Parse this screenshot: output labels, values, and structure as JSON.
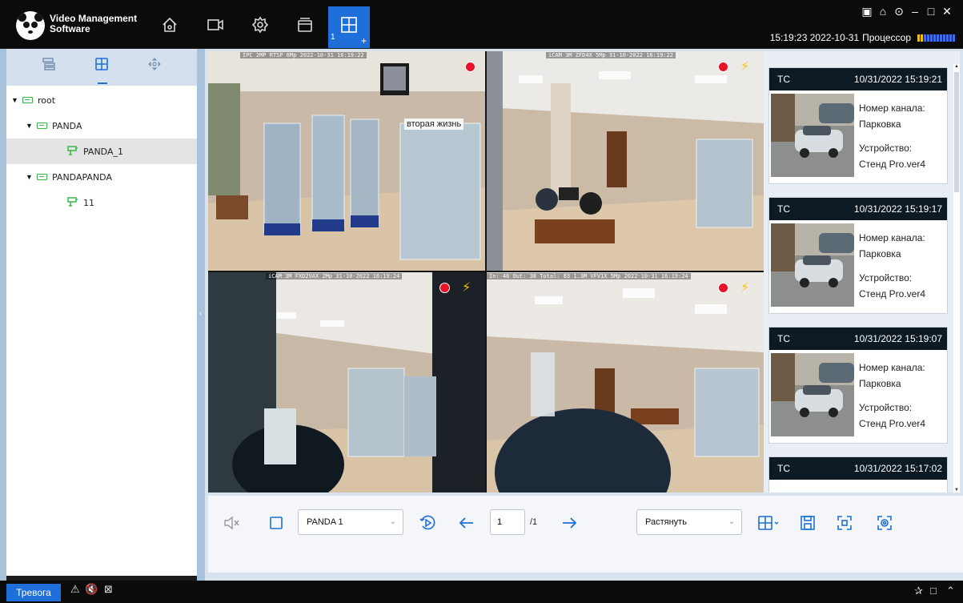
{
  "app": {
    "name_line1": "Video Management",
    "name_line2": "Software",
    "time": "15:19:23 2022-10-31",
    "cpu_label": "Процессор",
    "nav_layout_count": "1",
    "nav_layout_plus": "+"
  },
  "window_controls": [
    "▣",
    "⌂",
    "⊙",
    "–",
    "□",
    "✕"
  ],
  "tree": [
    {
      "label": "root",
      "level": 0,
      "type": "nvr"
    },
    {
      "label": "PANDA",
      "level": 1,
      "type": "nvr"
    },
    {
      "label": "PANDA_1",
      "level": 2,
      "type": "camera",
      "selected": true
    },
    {
      "label": "PANDAPANDA",
      "level": 1,
      "type": "nvr"
    },
    {
      "label": "11",
      "level": 2,
      "type": "camera"
    }
  ],
  "tiles": [
    {
      "osd": "IPC 2MP RTSP 6Mp     2022-10-31 16:19:22",
      "sign": "вторая жизнь",
      "rec": true,
      "motion": false
    },
    {
      "osd": "iCAM 3M ZFD4X 5Mp    31-10-2022 16:19:22",
      "rec": true,
      "motion": true
    },
    {
      "osd": "iCAM 3M FXD2VAX 2Mp    31-10-2022 16:19:24",
      "rec": true,
      "motion": true
    },
    {
      "osd": "In: 46 Out: 38 Total: 83 1.3M VFV1X 5Mp   2022-10-31 16:19:24",
      "rec": true,
      "motion": true
    }
  ],
  "events": [
    {
      "type": "TC",
      "time": "10/31/2022 15:19:21",
      "channel_label": "Номер канала:",
      "channel": "Парковка",
      "device_label": "Устройство:",
      "device": "Стенд Pro.ver4"
    },
    {
      "type": "TC",
      "time": "10/31/2022 15:19:17",
      "channel_label": "Номер канала:",
      "channel": "Парковка",
      "device_label": "Устройство:",
      "device": "Стенд Pro.ver4"
    },
    {
      "type": "TC",
      "time": "10/31/2022 15:19:07",
      "channel_label": "Номер канала:",
      "channel": "Парковка",
      "device_label": "Устройство:",
      "device": "Стенд Pro.ver4"
    },
    {
      "type": "TC",
      "time": "10/31/2022 15:17:02"
    }
  ],
  "toolbar": {
    "camera_select": "PANDA 1",
    "page_current": "1",
    "page_total": "/1",
    "stretch_select": "Растянуть"
  },
  "bottombar": {
    "alarm": "Тревога"
  },
  "colors": {
    "accent": "#1e6fd9",
    "titlebar": "#0b0b0b",
    "panel": "#d7e3ef",
    "rec": "#e8122a",
    "motion": "#f6c500"
  }
}
